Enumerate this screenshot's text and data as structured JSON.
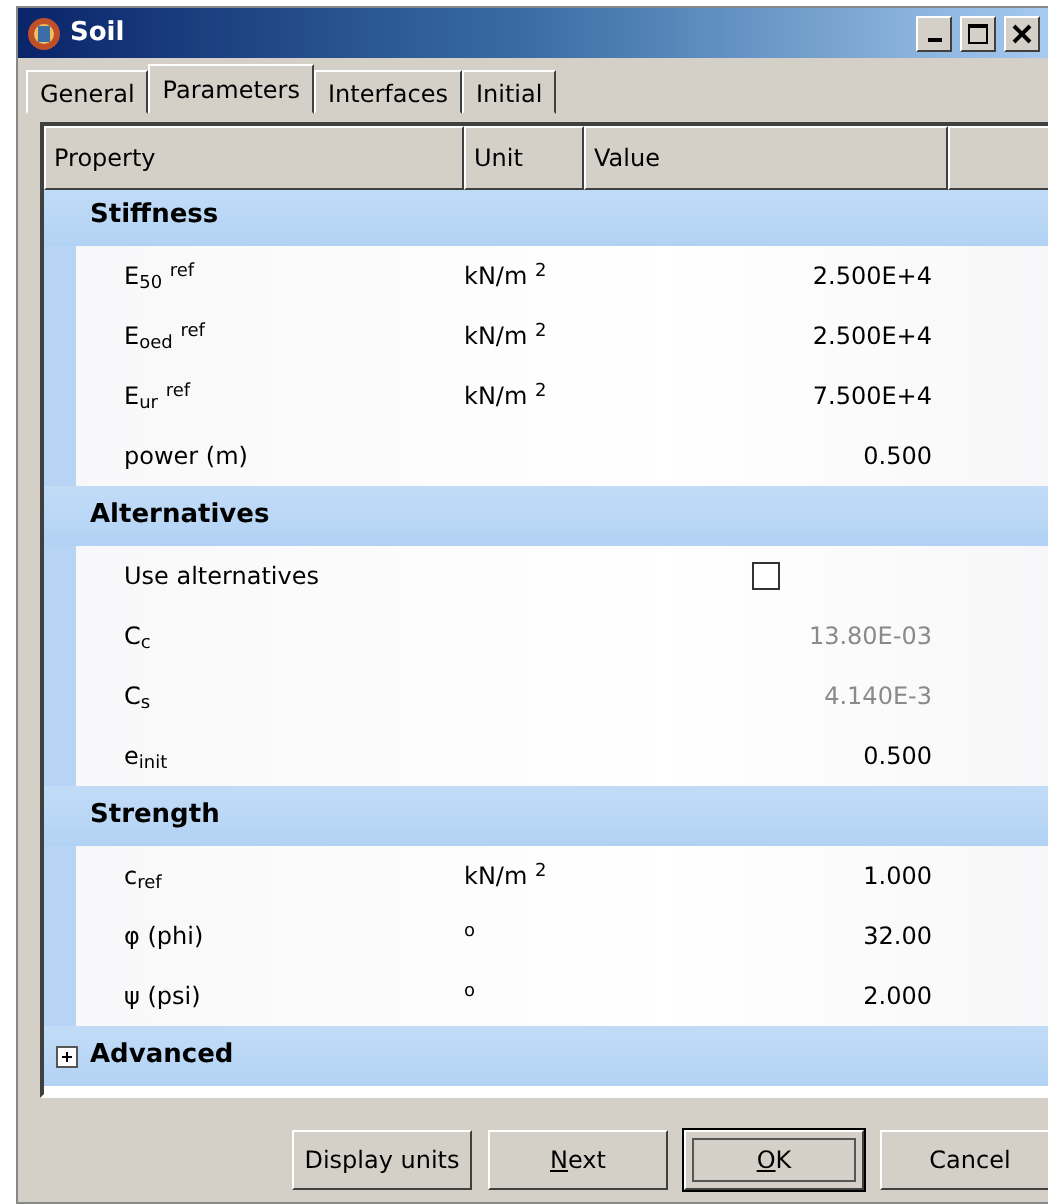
{
  "window": {
    "title": "Soil"
  },
  "tabs": [
    {
      "label": "General",
      "selected": false
    },
    {
      "label": "Parameters",
      "selected": true
    },
    {
      "label": "Interfaces",
      "selected": false
    },
    {
      "label": "Initial",
      "selected": false
    }
  ],
  "table": {
    "columns": [
      "Property",
      "Unit",
      "Value"
    ],
    "groups": [
      {
        "title": "Stiffness",
        "expanded": true,
        "rows": [
          {
            "kind": "value",
            "property": "E$_{50}$ $^{ref}$",
            "unit": "kN/m $^{2}$",
            "value": "2.500E+4",
            "disabled": false
          },
          {
            "kind": "value",
            "property": "E$_{oed}$ $^{ref}$",
            "unit": "kN/m $^{2}$",
            "value": "2.500E+4",
            "disabled": false
          },
          {
            "kind": "value",
            "property": "E$_{ur}$ $^{ref}$",
            "unit": "kN/m $^{2}$",
            "value": "7.500E+4",
            "disabled": false
          },
          {
            "kind": "value",
            "property": "power (m)",
            "value": "0.500",
            "disabled": false
          }
        ]
      },
      {
        "title": "Alternatives",
        "expanded": true,
        "rows": [
          {
            "kind": "checkbox",
            "property": "Use alternatives",
            "checked": false
          },
          {
            "kind": "value",
            "property": "C$_{c}$",
            "value": "13.80E-03",
            "disabled": true
          },
          {
            "kind": "value",
            "property": "C$_{s}$",
            "value": "4.140E-3",
            "disabled": true
          },
          {
            "kind": "value",
            "property": "e$_{init}$",
            "value": "0.500",
            "disabled": false
          }
        ]
      },
      {
        "title": "Strength",
        "expanded": true,
        "rows": [
          {
            "kind": "value",
            "property": "c$_{ref}$",
            "unit": "kN/m $^{2}$",
            "value": "1.000",
            "disabled": false
          },
          {
            "kind": "value",
            "property": "φ (phi)",
            "unit": "$^{o}$",
            "value": "32.00",
            "disabled": false
          },
          {
            "kind": "value",
            "property": "ψ (psi)",
            "unit": "$^{o}$",
            "value": "2.000",
            "disabled": false
          }
        ]
      },
      {
        "title": "Advanced",
        "expanded": false
      }
    ]
  },
  "buttons": [
    {
      "label": "Display units",
      "mnemonic": false,
      "default": false
    },
    {
      "label": "Next",
      "mnemonic": true,
      "default": false
    },
    {
      "label": "OK",
      "mnemonic": true,
      "default": true
    },
    {
      "label": "Cancel",
      "mnemonic": false,
      "default": false
    }
  ]
}
